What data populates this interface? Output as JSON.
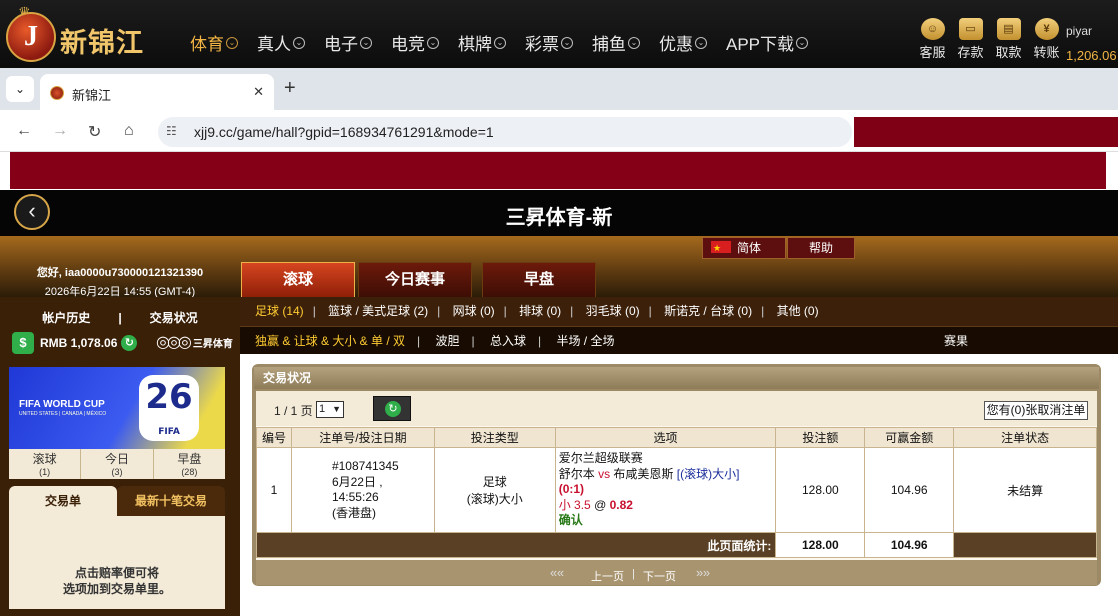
{
  "site": {
    "logo_letter": "J",
    "name": "新锦江",
    "nav": [
      {
        "label": "体育",
        "active": true
      },
      {
        "label": "真人",
        "active": false
      },
      {
        "label": "电子",
        "active": false
      },
      {
        "label": "电竞",
        "active": false
      },
      {
        "label": "棋牌",
        "active": false
      },
      {
        "label": "彩票",
        "active": false
      },
      {
        "label": "捕鱼",
        "active": false
      },
      {
        "label": "优惠",
        "active": false
      },
      {
        "label": "APP下载",
        "active": false
      }
    ],
    "tools": [
      "客服",
      "存款",
      "取款",
      "转账"
    ],
    "username": "piyar",
    "balance": "1,206.06"
  },
  "browser": {
    "tab_title": "新锦江",
    "url": "xjj9.cc/game/hall?gpid=168934761291&mode=1"
  },
  "game": {
    "title": "三昇体育-新",
    "greeting": "您好, iaa0000u730000121321390",
    "datetime": "2026年6月22日 14:55 (GMT-4)",
    "lang_label": "简体",
    "help_label": "帮助",
    "main_tabs": [
      {
        "label": "滚球",
        "active": true
      },
      {
        "label": "今日赛事",
        "active": false
      },
      {
        "label": "早盘",
        "active": false
      }
    ]
  },
  "left": {
    "account_history": "帐户历史",
    "divider": "|",
    "trade_status": "交易状况",
    "wallet": "RMB 1,078.06",
    "sponsor": "三昇体育",
    "banner_title": "FIFA WORLD CUP",
    "banner_hosts": "UNITED STATES | CANADA | MÉXICO",
    "banner_number": "26",
    "banner_fifa": "FIFA",
    "counts": [
      {
        "label": "滚球",
        "n": "(1)"
      },
      {
        "label": "今日",
        "n": "(3)"
      },
      {
        "label": "早盘",
        "n": "(28)"
      }
    ],
    "slip_tabs": [
      "交易单",
      "最新十笔交易"
    ],
    "slip_hint_1": "点击赔率便可将",
    "slip_hint_2": "选项加到交易单里。"
  },
  "sports": [
    {
      "label": "足球 (14)",
      "active": true
    },
    {
      "label": "篮球 / 美式足球 (2)",
      "active": false
    },
    {
      "label": "网球 (0)",
      "active": false
    },
    {
      "label": "排球 (0)",
      "active": false
    },
    {
      "label": "羽毛球 (0)",
      "active": false
    },
    {
      "label": "斯诺克 / 台球 (0)",
      "active": false
    },
    {
      "label": "其他 (0)",
      "active": false
    }
  ],
  "markets": [
    {
      "label": "独赢 & 让球 & 大小 & 单 / 双",
      "active": true
    },
    {
      "label": "波胆",
      "active": false
    },
    {
      "label": "总入球",
      "active": false
    },
    {
      "label": "半场 / 全场",
      "active": false
    }
  ],
  "results_label": "赛果",
  "panel": {
    "title": "交易状况",
    "page_info": "1 / 1 页",
    "page_value": "1",
    "cancel_label": "您有(0)张取消注单",
    "columns": [
      "编号",
      "注单号/投注日期",
      "投注类型",
      "选项",
      "投注额",
      "可赢金额",
      "注单状态"
    ],
    "rows": [
      {
        "no": "1",
        "ticket": "#108741345",
        "date": "6月22日 , 14:55:26",
        "market_type": "(香港盘)",
        "bet_type_1": "足球",
        "bet_type_2": "(滚球)大小",
        "league": "爱尔兰超级联赛",
        "home": "舒尔本",
        "vs": "vs",
        "away": "布咸美恩斯",
        "rolling": "[(滚球)大小]",
        "score": "(0:1)",
        "pick": "小 3.5",
        "at": "@",
        "odds": "0.82",
        "confirm": "确认",
        "stake": "128.00",
        "win": "104.96",
        "status": "未结算"
      }
    ],
    "total_label": "此页面统计:",
    "total_stake": "128.00",
    "total_win": "104.96",
    "prev": "上一页",
    "next": "下一页"
  }
}
